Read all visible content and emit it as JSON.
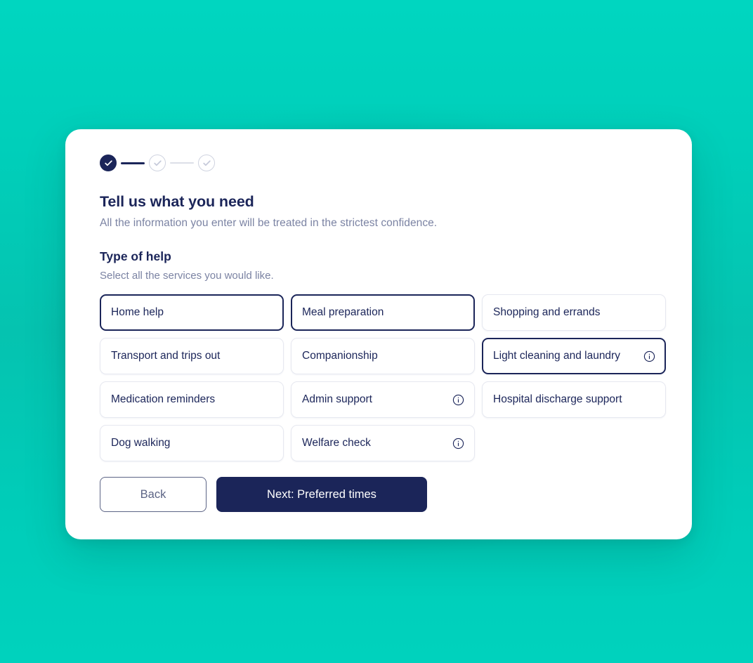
{
  "theme": {
    "background_teal": "#00cdb8",
    "navy": "#1b2559",
    "muted_text": "#7b83a3",
    "card_background": "#ffffff",
    "border_idle": "#e6e8f0"
  },
  "stepper": {
    "steps": [
      {
        "id": "step-1",
        "state": "done",
        "icon": "check-icon"
      },
      {
        "id": "step-2",
        "state": "todo",
        "icon": "check-icon"
      },
      {
        "id": "step-3",
        "state": "todo",
        "icon": "check-icon"
      }
    ],
    "connectors": [
      {
        "id": "connector-1-2",
        "style": "solid"
      },
      {
        "id": "connector-2-3",
        "style": "faint"
      }
    ]
  },
  "header": {
    "title": "Tell us what you need",
    "subtitle": "All the information you enter will be treated in the strictest confidence."
  },
  "section": {
    "title": "Type of help",
    "subtitle": "Select all the services you would like."
  },
  "options": [
    {
      "label": "Home help",
      "selected": true,
      "info": false
    },
    {
      "label": "Meal preparation",
      "selected": true,
      "info": false
    },
    {
      "label": "Shopping and errands",
      "selected": false,
      "info": false
    },
    {
      "label": "Transport and trips out",
      "selected": false,
      "info": false
    },
    {
      "label": "Companionship",
      "selected": false,
      "info": false
    },
    {
      "label": "Light cleaning and laundry",
      "selected": true,
      "info": true
    },
    {
      "label": "Medication reminders",
      "selected": false,
      "info": false
    },
    {
      "label": "Admin support",
      "selected": false,
      "info": true
    },
    {
      "label": "Hospital discharge support",
      "selected": false,
      "info": false
    },
    {
      "label": "Dog walking",
      "selected": false,
      "info": false
    },
    {
      "label": "Welfare check",
      "selected": false,
      "info": true
    }
  ],
  "actions": {
    "back_label": "Back",
    "next_label": "Next: Preferred times"
  }
}
